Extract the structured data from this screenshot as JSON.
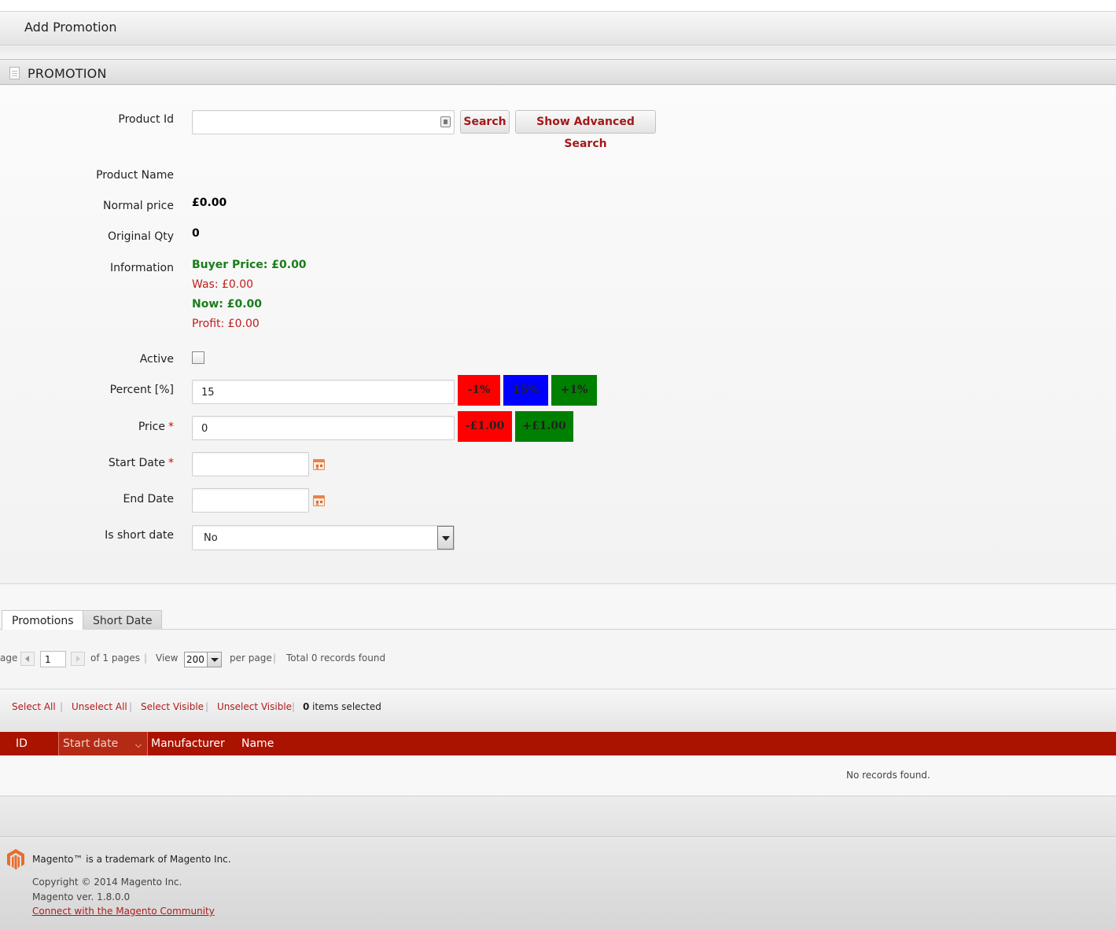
{
  "header": {
    "title": "Add Promotion"
  },
  "section": {
    "title": "PROMOTION"
  },
  "form": {
    "product_id": {
      "label": "Product Id",
      "value": ""
    },
    "search_button": "Search",
    "advanced_search_button": "Show Advanced Search",
    "product_name": {
      "label": "Product Name",
      "value": ""
    },
    "normal_price": {
      "label": "Normal price",
      "value": "£0.00"
    },
    "original_qty": {
      "label": "Original Qty",
      "value": "0"
    },
    "information": {
      "label": "Information",
      "buyer_price": "Buyer Price: £0.00",
      "was": "Was: £0.00",
      "now": "Now: £0.00",
      "profit": "Profit: £0.00"
    },
    "active": {
      "label": "Active",
      "checked": false
    },
    "percent": {
      "label": "Percent [%]",
      "value": "15",
      "buttons": [
        {
          "label": "-1%",
          "color": "#ff0000"
        },
        {
          "label": "15%",
          "color": "#0000ff"
        },
        {
          "label": "+1%",
          "color": "#008000"
        }
      ]
    },
    "price": {
      "label": "Price",
      "value": "0",
      "buttons": [
        {
          "label": "-£1.00",
          "color": "#ff0000"
        },
        {
          "label": "+£1.00",
          "color": "#008000"
        }
      ]
    },
    "start_date": {
      "label": "Start Date",
      "value": ""
    },
    "end_date": {
      "label": "End Date",
      "value": ""
    },
    "is_short_date": {
      "label": "Is short date",
      "value": "No"
    },
    "required_mark": "*"
  },
  "tabs": [
    {
      "label": "Promotions",
      "active": true
    },
    {
      "label": "Short Date",
      "active": false
    }
  ],
  "pager": {
    "page_prefix": "age",
    "page_value": "1",
    "of_pages": "of 1 pages",
    "view_label": "View",
    "per_page_value": "200",
    "per_page_label": "per page",
    "total": "Total 0 records found"
  },
  "massaction": {
    "select_all": "Select All",
    "unselect_all": "Unselect All",
    "select_visible": "Select Visible",
    "unselect_visible": "Unselect Visible",
    "selected_count": "0",
    "selected_label": "items selected"
  },
  "grid": {
    "columns": [
      "ID",
      "Start date",
      "Manufacturer",
      "Name"
    ],
    "empty_text": "No records found.",
    "header_color": "#ab1301"
  },
  "footer": {
    "trademark": "Magento™ is a trademark of Magento Inc.",
    "copyright": "Copyright © 2014 Magento Inc.",
    "version": "Magento ver. 1.8.0.0",
    "community_link": "Connect with the Magento Community"
  }
}
